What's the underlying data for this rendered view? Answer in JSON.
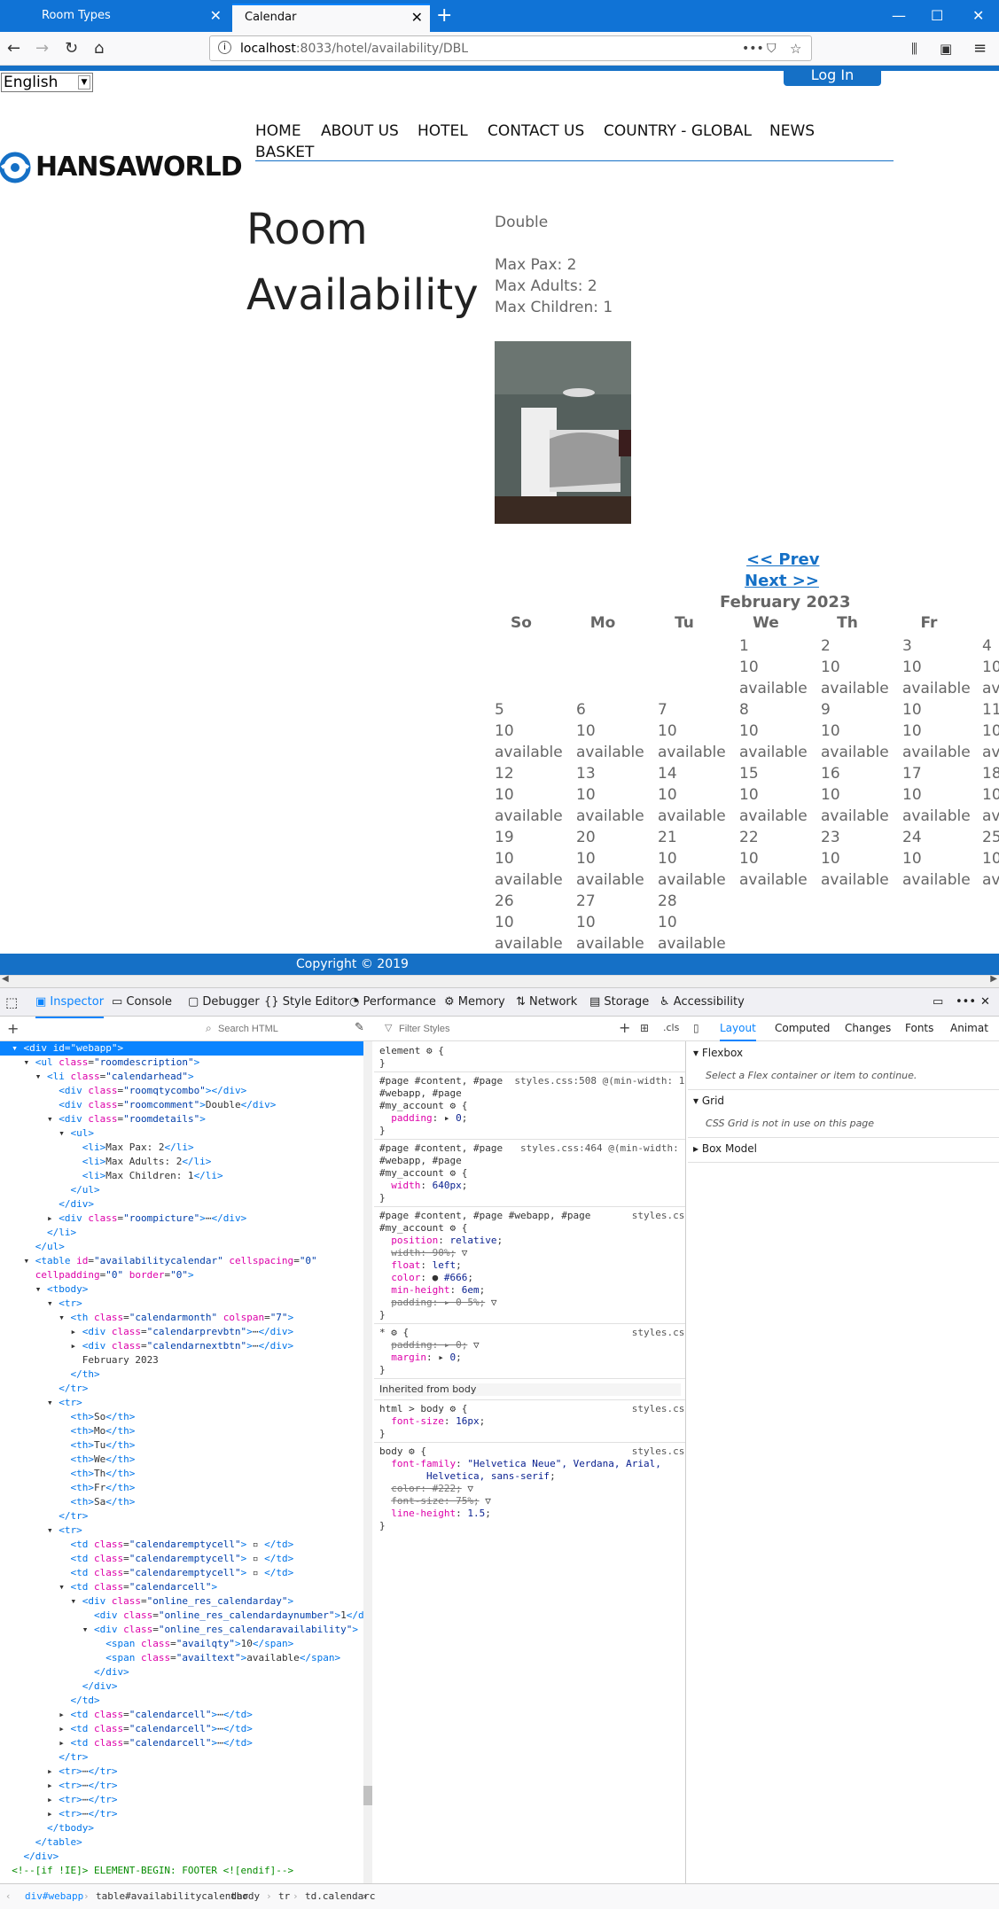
{
  "browser": {
    "tabs": [
      {
        "label": "Room Types"
      },
      {
        "label": "Calendar"
      }
    ],
    "url_host": "localhost",
    "url_rest": ":8033/hotel/availability/DBL"
  },
  "page": {
    "language": "English",
    "login_label": "Log In",
    "logo_text": "HANSAWORLD",
    "nav": [
      "HOME",
      "ABOUT US",
      "HOTEL",
      "CONTACT US",
      "COUNTRY - GLOBAL",
      "NEWS",
      "BASKET"
    ],
    "title_line1": "Room",
    "title_line2": "Availability",
    "room_type": "Double",
    "details": [
      "Max Pax: 2",
      "Max Adults: 2",
      "Max Children: 1"
    ],
    "prev_label": "<< Prev",
    "next_label": "Next >>",
    "month": "February 2023",
    "weekdays": [
      "So",
      "Mo",
      "Tu",
      "We",
      "Th",
      "Fr"
    ],
    "weeks": [
      [
        "",
        "",
        "",
        "1",
        "2",
        "3",
        "4"
      ],
      [
        "5",
        "6",
        "7",
        "8",
        "9",
        "10",
        "11"
      ],
      [
        "12",
        "13",
        "14",
        "15",
        "16",
        "17",
        "18"
      ],
      [
        "19",
        "20",
        "21",
        "22",
        "23",
        "24",
        "25"
      ],
      [
        "26",
        "27",
        "28",
        "",
        "",
        "",
        ""
      ]
    ],
    "avail_qty": "10",
    "avail_text": "available",
    "footer": "Copyright © 2019"
  },
  "devtools": {
    "tabs": [
      "Inspector",
      "Console",
      "Debugger",
      "Style Editor",
      "Performance",
      "Memory",
      "Network",
      "Storage",
      "Accessibility"
    ],
    "search_placeholder": "Search HTML",
    "filter_placeholder": "Filter Styles",
    "layout_tabs": [
      "Layout",
      "Computed",
      "Changes",
      "Fonts",
      "Animat"
    ],
    "flexbox_label": "Flexbox",
    "flexbox_msg": "Select a Flex container or item to continue.",
    "grid_label": "Grid",
    "grid_msg": "CSS Grid is not in use on this page",
    "boxmodel_label": "Box Model",
    "inherited_label": "Inherited from body",
    "breadcrumb": [
      "div#webapp",
      "table#availabilitycalendar",
      "tbody",
      "tr",
      "td.calendarc"
    ]
  }
}
